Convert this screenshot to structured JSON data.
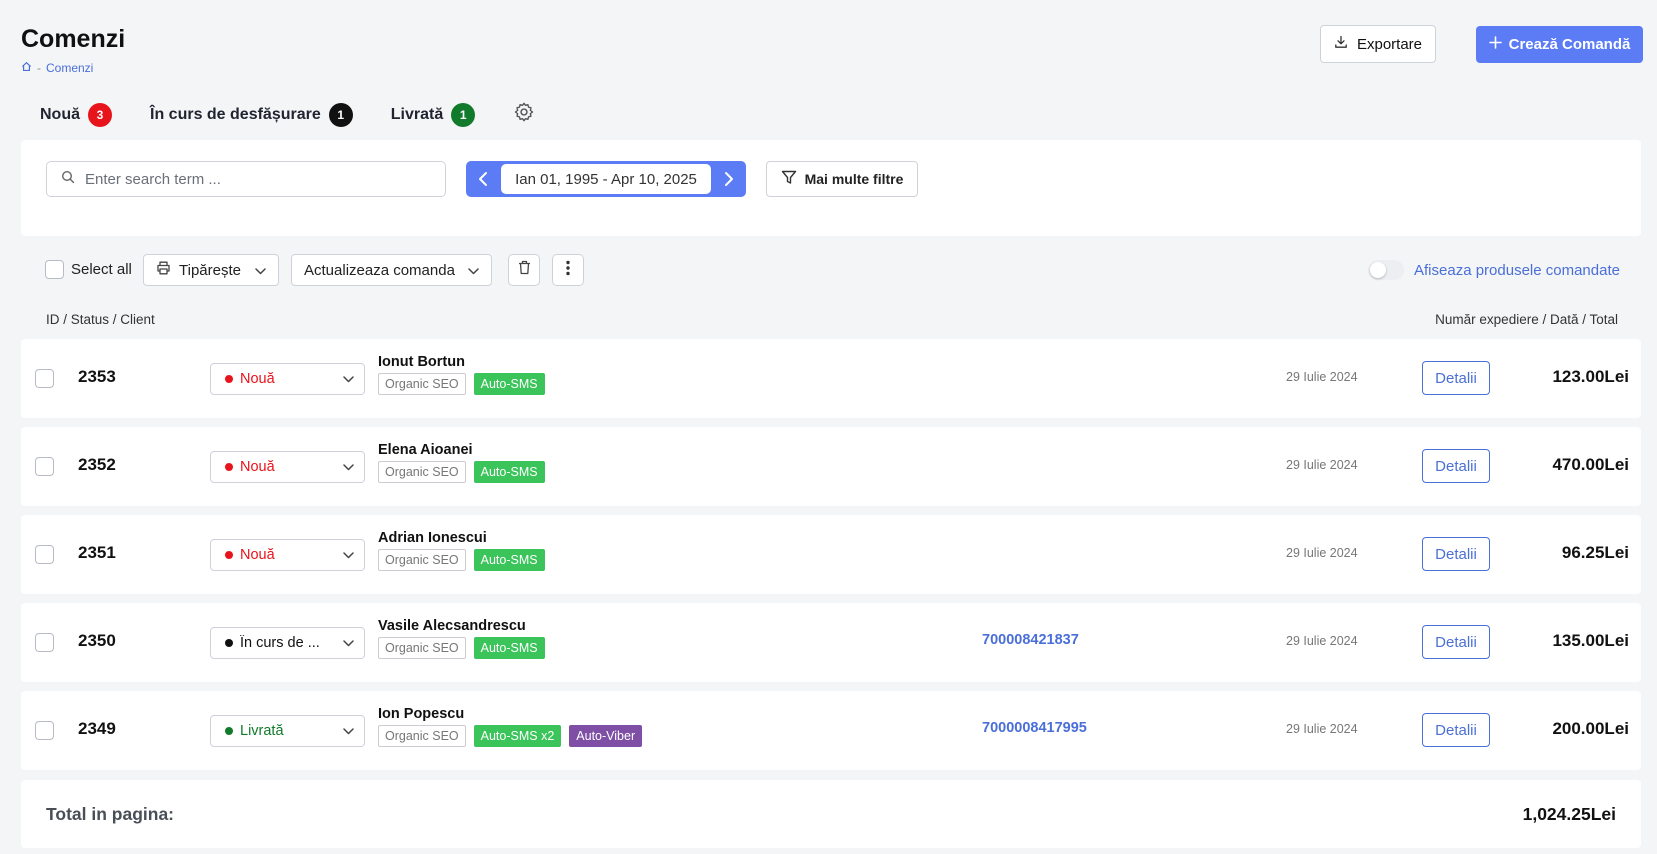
{
  "header": {
    "title": "Comenzi",
    "breadcrumb_sep": "-",
    "breadcrumb_current": "Comenzi",
    "export_label": "Exportare",
    "create_label": "Crează Comandă"
  },
  "tabs": [
    {
      "label": "Nouă",
      "count": "3",
      "color": "#e8141b"
    },
    {
      "label": "În curs de desfășurare",
      "count": "1",
      "color": "#111111"
    },
    {
      "label": "Livrată",
      "count": "1",
      "color": "#127a2b"
    }
  ],
  "filters": {
    "search_placeholder": "Enter search term ...",
    "date_range": "Ian 01, 1995 - Apr 10, 2025",
    "more_filters_label": "Mai multe filtre"
  },
  "toolbar": {
    "select_all_label": "Select all",
    "print_label": "Tipărește",
    "update_label": "Actualizeaza comanda",
    "toggle_label": "Afiseaza produsele comandate"
  },
  "columns": {
    "left": "ID / Status / Client",
    "right": "Număr expediere / Dată / Total"
  },
  "orders": [
    {
      "id": "2353",
      "status": "Nouă",
      "status_color": "#e8141b",
      "client": "Ionut Bortun",
      "tags": [
        "Organic SEO",
        "Auto-SMS"
      ],
      "tracking": "",
      "date": "29 Iulie 2024",
      "details_label": "Detalii",
      "total": "123.00Lei"
    },
    {
      "id": "2352",
      "status": "Nouă",
      "status_color": "#e8141b",
      "client": "Elena Aioanei",
      "tags": [
        "Organic SEO",
        "Auto-SMS"
      ],
      "tracking": "",
      "date": "29 Iulie 2024",
      "details_label": "Detalii",
      "total": "470.00Lei"
    },
    {
      "id": "2351",
      "status": "Nouă",
      "status_color": "#e8141b",
      "client": "Adrian Ionescui",
      "tags": [
        "Organic SEO",
        "Auto-SMS"
      ],
      "tracking": "",
      "date": "29 Iulie 2024",
      "details_label": "Detalii",
      "total": "96.25Lei"
    },
    {
      "id": "2350",
      "status": "În curs de ...",
      "status_color": "#111111",
      "client": "Vasile Alecsandrescu",
      "tags": [
        "Organic SEO",
        "Auto-SMS"
      ],
      "tracking": "700008421837",
      "date": "29 Iulie 2024",
      "details_label": "Detalii",
      "total": "135.00Lei"
    },
    {
      "id": "2349",
      "status": "Livrată",
      "status_color": "#127a2b",
      "client": "Ion Popescu",
      "tags": [
        "Organic SEO",
        "Auto-SMS x2",
        "Auto-Viber"
      ],
      "tracking": "7000008417995",
      "date": "29 Iulie 2024",
      "details_label": "Detalii",
      "total": "200.00Lei"
    }
  ],
  "footer": {
    "total_label": "Total in pagina:",
    "total_value": "1,024.25Lei"
  },
  "colors": {
    "accent": "#5b7cf5",
    "link": "#4a6fd8",
    "tag_green": "#3bc45a",
    "tag_purple": "#7e4fa5"
  }
}
